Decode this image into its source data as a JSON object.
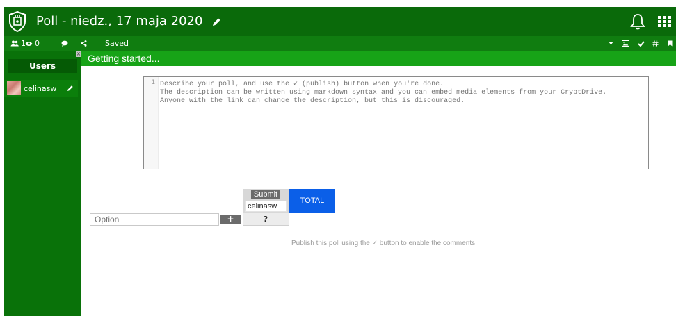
{
  "header": {
    "title": "Poll - niedz., 17 maja 2020"
  },
  "toolbar": {
    "users_count": "1",
    "viewers_count": "0",
    "status": "Saved"
  },
  "banner": {
    "text": "Getting started..."
  },
  "sidebar": {
    "heading": "Users",
    "users": [
      {
        "name": "celinasw"
      }
    ]
  },
  "editor": {
    "line_number": "1",
    "lines": [
      "Describe your poll, and use the ✓ (publish) button when you're done.",
      "The description can be written using markdown syntax and you can embed media elements from your CryptDrive.",
      "Anyone with the link can change the description, but this is discouraged."
    ]
  },
  "poll": {
    "submit_label": "Submit",
    "user_name_value": "celinasw",
    "total_label": "TOTAL",
    "option_placeholder": "Option",
    "add_label": "+",
    "unknown_label": "?"
  },
  "comments": {
    "hint": "Publish this poll using the ✓ button to enable the comments."
  },
  "colors": {
    "title_bar": "#0a6a0a",
    "toolbar": "#107d10",
    "banner": "#17a317",
    "sidebar": "#097209",
    "total": "#0b5fe8"
  }
}
